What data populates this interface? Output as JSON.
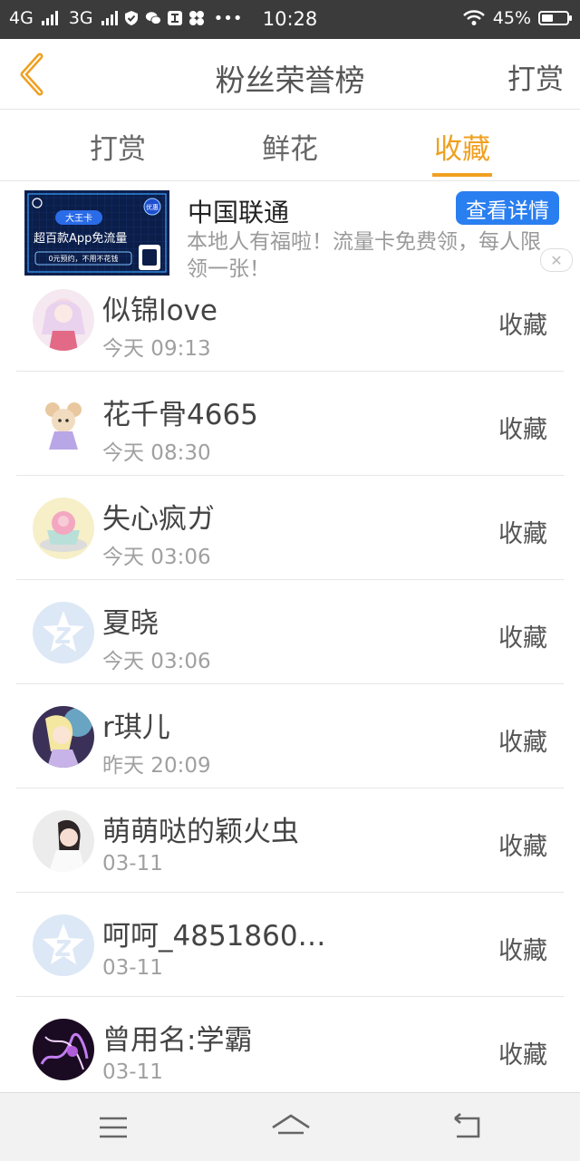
{
  "status": {
    "net1": "4G",
    "net2": "3G",
    "time": "10:28",
    "battery": "45%"
  },
  "header": {
    "title": "粉丝荣誉榜",
    "right_action": "打赏"
  },
  "tabs": [
    {
      "label": "打赏"
    },
    {
      "label": "鲜花"
    },
    {
      "label": "收藏"
    }
  ],
  "ad": {
    "title": "中国联通",
    "description": "本地人有福啦！流量卡免费领，每人限领一张！",
    "button": "查看详情",
    "close": "✕",
    "image_text": {
      "card": "大王卡",
      "badge": "优惠",
      "headline": "超百款App免流量",
      "sub": "0元预约，不用不花钱"
    }
  },
  "list": [
    {
      "name": "似锦love",
      "time": "今天 09:13",
      "action": "收藏"
    },
    {
      "name": "花千骨4665",
      "time": "今天 08:30",
      "action": "收藏"
    },
    {
      "name": "失心疯ガ",
      "time": "今天 03:06",
      "action": "收藏"
    },
    {
      "name": "夏晓",
      "time": "今天 03:06",
      "action": "收藏"
    },
    {
      "name": "r琪儿",
      "time": "昨天 20:09",
      "action": "收藏"
    },
    {
      "name": "萌萌哒的颖火虫",
      "time": "03-11",
      "action": "收藏"
    },
    {
      "name": "呵呵_4851860…",
      "time": "03-11",
      "action": "收藏"
    },
    {
      "name": "曾用名:学霸",
      "time": "03-11",
      "action": "收藏"
    }
  ],
  "colors": {
    "accent": "#f0a020",
    "ad_button": "#2a7ff0",
    "status_bar": "#3b3b3b"
  }
}
